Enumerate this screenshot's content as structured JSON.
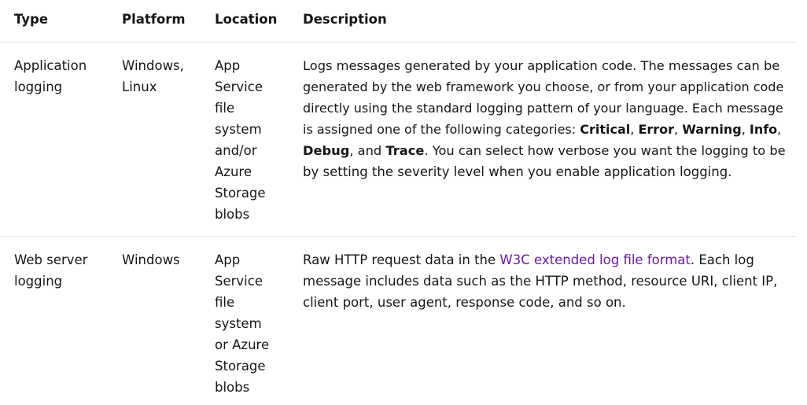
{
  "headers": {
    "type": "Type",
    "platform": "Platform",
    "location": "Location",
    "description": "Description"
  },
  "rows": [
    {
      "type_lines": [
        "Application",
        "logging"
      ],
      "platform_lines": [
        "Windows,",
        "Linux"
      ],
      "location_lines": [
        "App",
        "Service",
        "file",
        "system",
        "and/or",
        "Azure",
        "Storage",
        "blobs"
      ],
      "description": {
        "l1": "Logs messages generated by your application code. The messages can be",
        "l2": "generated by the web framework you choose, or from your application code",
        "l3": "directly using the standard logging pattern of your language. Each message",
        "l4_pre": "is assigned one of the following categories: ",
        "cat_critical": "Critical",
        "sep1": ", ",
        "cat_error": "Error",
        "sep2": ", ",
        "cat_warning": "Warning",
        "sep3": ", ",
        "cat_info": "Info",
        "sep4": ",",
        "cat_debug": "Debug",
        "sep5": ", and ",
        "cat_trace": "Trace",
        "l5_post": ". You can select how verbose you want the logging to be",
        "l6": "by setting the severity level when you enable application logging."
      }
    },
    {
      "type_lines": [
        "Web server",
        "logging"
      ],
      "platform_lines": [
        "Windows"
      ],
      "location_lines": [
        "App",
        "Service",
        "file",
        "system",
        "or Azure",
        "Storage",
        "blobs"
      ],
      "description": {
        "l1_pre": "Raw HTTP request data in the ",
        "link": "W3C extended log file format",
        "l1_post": ". Each log",
        "l2": "message includes data such as the HTTP method, resource URI, client IP,",
        "l3": "client port, user agent, response code, and so on."
      }
    }
  ],
  "colors": {
    "text": "#161616",
    "link": "#6a1b9a",
    "divider": "#e1e1e1"
  }
}
